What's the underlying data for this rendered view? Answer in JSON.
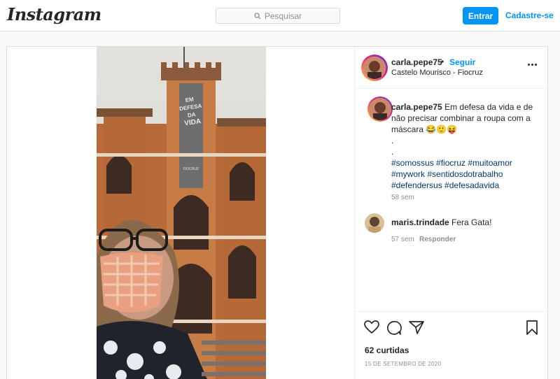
{
  "nav": {
    "logo": "Instagram",
    "search_placeholder": "Pesquisar",
    "login_label": "Entrar",
    "signup_label": "Cadastre-se"
  },
  "post": {
    "username": "carla.pepe75",
    "separator": "•",
    "follow_label": "Seguir",
    "location": "Castelo Mourisco - Fiocruz",
    "banner_text": [
      "EM",
      "DEFESA",
      "DA",
      "VIDA"
    ],
    "banner_footer": "FIOCRUZ",
    "caption": {
      "username": "carla.pepe75",
      "text": "Em defesa da vida e de não precisar combinar a roupa com a máscara 😂🙂😝",
      "dots": [
        ".",
        "."
      ],
      "hashtags_line1": "#somossus #fiocruz #muitoamor",
      "hashtags_line2": "#mywork #sentidosdotrabalho",
      "hashtags_line3": "#defendersus #defesadavida",
      "time": "58 sem"
    },
    "comments": [
      {
        "username": "maris.trindade",
        "text": "Fera Gata!",
        "time": "57 sem",
        "reply_label": "Responder"
      }
    ],
    "likes": "62 curtidas",
    "date": "15 DE SETEMBRO DE 2020"
  },
  "colors": {
    "accent": "#0095f6",
    "border": "#dbdbdb",
    "muted": "#8e8e8e",
    "hashtag": "#00376b"
  },
  "icons": [
    "search-icon",
    "more-options-icon",
    "heart-icon",
    "comment-icon",
    "share-icon",
    "bookmark-icon"
  ]
}
